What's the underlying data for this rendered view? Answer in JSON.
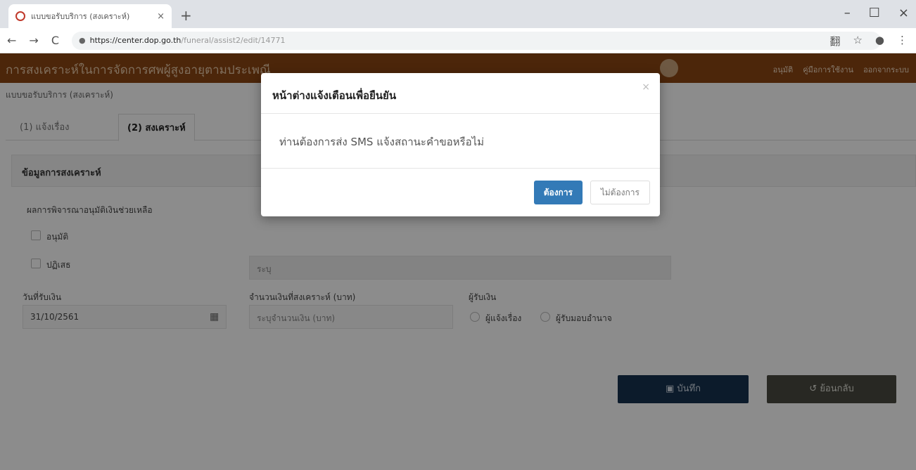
{
  "browser": {
    "tab_title": "แบบขอรับบริการ (สงเคราะห์)",
    "tab_close": "×",
    "new_tab": "+",
    "url_host": "https://center.dop.go.th",
    "url_path": "/funeral/assist2/edit/14771",
    "back": "←",
    "forward": "→",
    "reload": "C",
    "lock": "●",
    "translate": "翻",
    "star": "☆",
    "account": "●",
    "menu": "⋮",
    "minimize": "–",
    "maximize": "☐",
    "close": "×"
  },
  "app": {
    "title": "การสงเคราะห์ในการจัดการศพผู้สูงอายุตามประเพณี",
    "nav": [
      "อนุมัติ",
      "คู่มือการใช้งาน",
      "ออกจากระบบ"
    ]
  },
  "page": {
    "breadcrumb": "แบบขอรับบริการ (สงเคราะห์)",
    "tabs": [
      {
        "label": "(1) แจ้งเรื่อง"
      },
      {
        "label": "(2) สงเคราะห์"
      }
    ],
    "section_title": "ข้อมูลการสงเคราะห์",
    "approval_label": "ผลการพิจารณาอนุมัติเงินช่วยเหลือ",
    "option_approve": "อนุมัติ",
    "option_reject": "ปฏิเสธ",
    "reason_placeholder": "ระบุ",
    "date_label": "วันที่รับเงิน",
    "date_value": "31/10/2561",
    "amount_label": "จำนวนเงินที่สงเคราะห์ (บาท)",
    "amount_placeholder": "ระบุจำนวนเงิน (บาท)",
    "receiver_label": "ผู้รับเงิน",
    "receiver_opt1": "ผู้แจ้งเรื่อง",
    "receiver_opt2": "ผู้รับมอบอำนาจ",
    "save_label": "บันทึก",
    "back_label": "ย้อนกลับ"
  },
  "modal": {
    "title": "หน้าต่างแจ้งเตือนเพื่อยืนยัน",
    "message": "ท่านต้องการส่ง SMS แจ้งสถานะคำขอหรือไม่",
    "confirm": "ต้องการ",
    "cancel": "ไม่ต้องการ",
    "close": "×"
  },
  "colors": {
    "app_bar": "#8b4513",
    "primary": "#337ab7",
    "save_button": "#17324f",
    "back_button": "#4a4a40"
  }
}
